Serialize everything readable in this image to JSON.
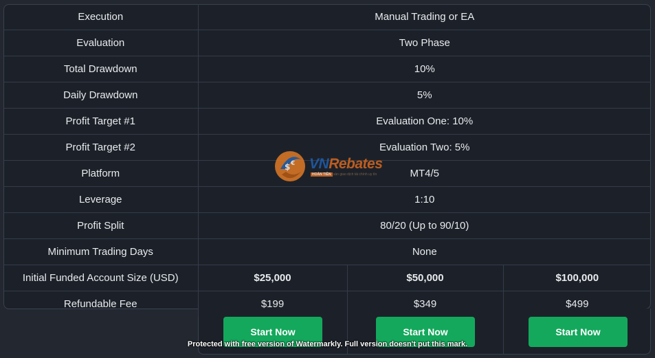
{
  "rows": [
    {
      "label": "Execution",
      "value": "Manual Trading or EA"
    },
    {
      "label": "Evaluation",
      "value": "Two Phase"
    },
    {
      "label": "Total Drawdown",
      "value": "10%"
    },
    {
      "label": "Daily Drawdown",
      "value": "5%"
    },
    {
      "label": "Profit Target #1",
      "value": "Evaluation One: 10%"
    },
    {
      "label": "Profit Target #2",
      "value": "Evaluation Two: 5%"
    },
    {
      "label": "Platform",
      "value": "MT4/5"
    },
    {
      "label": "Leverage",
      "value": "1:10"
    },
    {
      "label": "Profit Split",
      "value": "80/20 (Up to 90/10)"
    },
    {
      "label": "Minimum Trading Days",
      "value": "None"
    }
  ],
  "account_size": {
    "label": "Initial Funded Account Size (USD)",
    "values": [
      "$25,000",
      "$50,000",
      "$100,000"
    ]
  },
  "fee": {
    "label": "Refundable Fee",
    "values": [
      "$199",
      "$349",
      "$499"
    ]
  },
  "buttons": [
    "Start Now",
    "Start Now",
    "Start Now"
  ],
  "watermark": "Protected with free version of Watermarkly. Full version doesn't put this mark.",
  "logo": {
    "name_prefix": "VN",
    "name_suffix": "Rebates",
    "badge": "HOÀN TIỀN",
    "tagline": "sàn giao dịch tài chính uy tín"
  },
  "colors": {
    "background": "#232830",
    "table_background": "#1c2129",
    "button": "#14a85c",
    "text": "#e8eaed"
  }
}
